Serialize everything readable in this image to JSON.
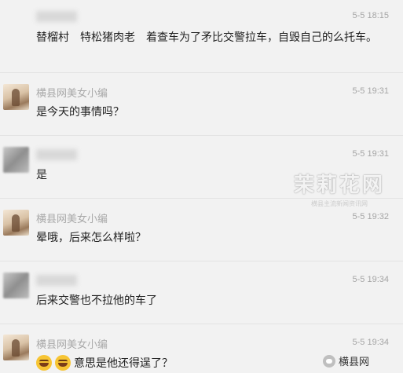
{
  "messages": [
    {
      "sender": "",
      "time": "5-5 18:15",
      "text": "替榴村　特松猪肉老　着查车为了矛比交警拉车，自毁自己的么托车。"
    },
    {
      "sender": "横县网美女小编",
      "time": "5-5 19:31",
      "text": "是今天的事情吗？"
    },
    {
      "sender": "",
      "time": "5-5 19:31",
      "text": "是"
    },
    {
      "sender": "横县网美女小编",
      "time": "5-5 19:32",
      "text": "晕哦，后来怎么样啦？"
    },
    {
      "sender": "",
      "time": "5-5 19:34",
      "text": "后来交警也不拉他的车了"
    },
    {
      "sender": "横县网美女小编",
      "time": "5-5 19:34",
      "text": "意思是他还得逞了？"
    }
  ],
  "watermark": {
    "main": "茉莉花网",
    "sub": "横县主流新闻资讯网"
  },
  "brand": {
    "label": "横县网",
    "icon": "wechat-icon"
  },
  "colors": {
    "background": "#f2f2f2",
    "meta_text": "#a5a5a5",
    "body_text": "#222222"
  }
}
